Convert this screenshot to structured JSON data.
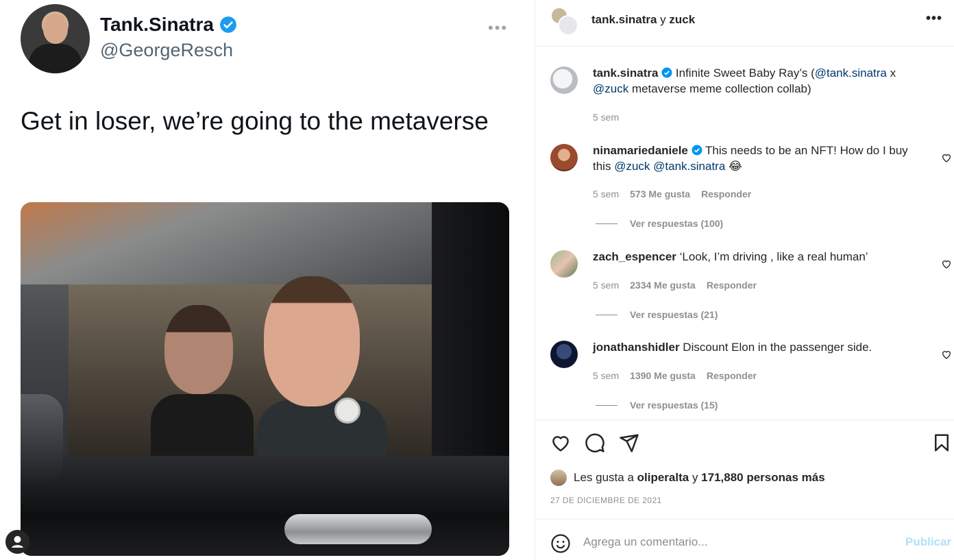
{
  "tweet": {
    "name": "Tank.Sinatra",
    "handle": "@GeorgeResch",
    "more": "•••",
    "text": "Get in loser, we’re going to the metaverse",
    "avatar_icon": "profile-photo"
  },
  "header": {
    "user1": "tank.sinatra",
    "connector": " y ",
    "user2": "zuck",
    "more": "•••"
  },
  "caption": {
    "username": "tank.sinatra",
    "text": " Infinite Sweet Baby Ray’s (",
    "mention1": "@tank.sinatra",
    "mid": " x ",
    "mention2": "@zuck",
    "tail": " metaverse meme collection collab)",
    "time": "5 sem"
  },
  "comments": [
    {
      "username": "ninamariedaniele",
      "text_before": " This needs to be an NFT! How do I buy this ",
      "mention1": "@zuck",
      "mid": " ",
      "mention2": "@tank.sinatra",
      "tail": " 😂",
      "time": "5 sem",
      "likes": "573 Me gusta",
      "reply": "Responder",
      "view_replies": "Ver respuestas (100)"
    },
    {
      "username": "zach_espencer",
      "text": " ‘Look, I’m driving , like a real human’",
      "time": "5 sem",
      "likes": "2334 Me gusta",
      "reply": "Responder",
      "view_replies": "Ver respuestas (21)"
    },
    {
      "username": "jonathanshidler",
      "text": " Discount Elon in the passenger side.",
      "time": "5 sem",
      "likes": "1390 Me gusta",
      "reply": "Responder",
      "view_replies": "Ver respuestas (15)"
    }
  ],
  "likes": {
    "prefix": "Les gusta a ",
    "user": "oliperalta",
    "connector": " y ",
    "count": "171,880 personas más"
  },
  "date": "27 DE DICIEMBRE DE 2021",
  "compose": {
    "placeholder": "Agrega un comentario...",
    "publish": "Publicar"
  },
  "colors": {
    "verified": "#0095f6",
    "mention": "#00376b",
    "publish_disabled": "#b2dffc",
    "twitter_verified": "#1d9bf0"
  }
}
